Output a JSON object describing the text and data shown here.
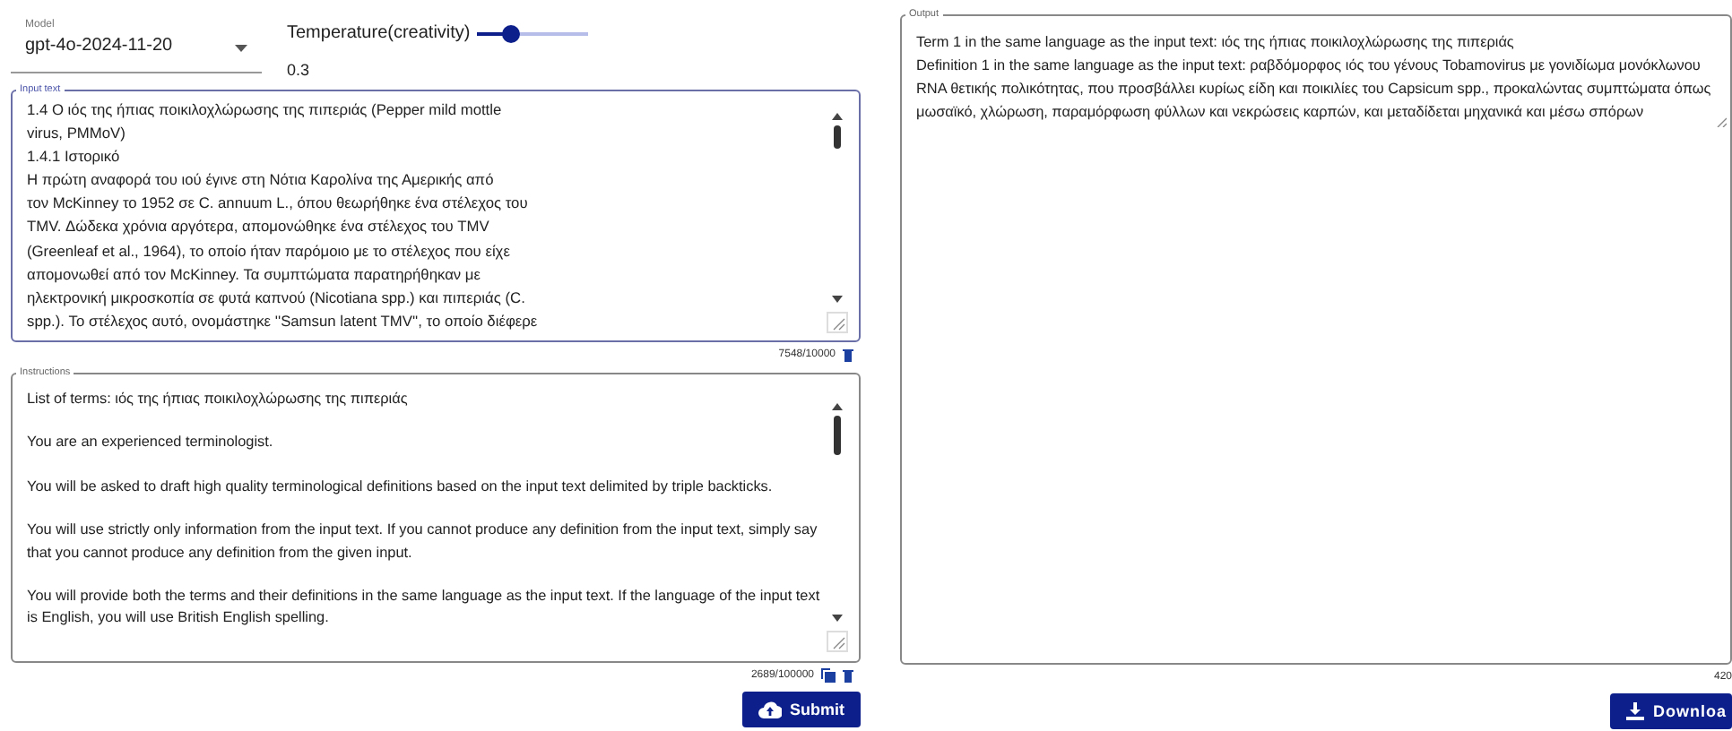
{
  "model_select": {
    "label": "Model",
    "value": "gpt-4o-2024-11-20"
  },
  "temperature": {
    "label": "Temperature(creativity)",
    "level": 0.3,
    "reading": "0.3"
  },
  "input_text": {
    "label": "Input text",
    "lines": [
      "1.4 Ο ιός της ήπιας ποικιλοχλώρωσης της πιπεριάς (Pepper mild mottle",
      "virus, PMMoV)",
      "1.4.1 Ιστορικό",
      "Η πρώτη αναφορά του ιού έγινε στη Νότια Καρολίνα της Αμερικής από",
      "τον McKinney το 1952 σε C. annuum L., όπου θεωρήθηκε ένα στέλεχος του",
      "TMV. Δώδεκα χρόνια αργότερα, απομονώθηκε ένα στέλεχος του TMV",
      "(Greenleaf et al., 1964), το οποίο ήταν παρόμοιο με το στέλεχος που είχε",
      "απομονωθεί από τον McKinney. Τα συμπτώματα παρατηρήθηκαν με",
      "ηλεκτρονική μικροσκοπία σε φυτά καπνού (Nicotiana spp.) και πιπεριάς (C.",
      "spp.). Το στέλεχος αυτό, ονομάστηκε ''Samsun latent TMV'', το οποίο διέφερε"
    ],
    "counter": "7548/10000"
  },
  "instructions": {
    "label": "Instructions",
    "paragraphs": [
      "List of terms: ιός της ήπιας ποικιλοχλώρωσης της πιπεριάς",
      "You are an experienced terminologist.",
      "You will be asked to draft high quality terminological definitions based on the input text delimited by triple backticks.",
      "You will use strictly only information from the input text. If you cannot produce any definition from the input text, simply say that you cannot produce any definition from the given input.",
      "You will provide both the terms and their definitions in the same language as the input text. If the language of the input text is English, you will use British English spelling."
    ],
    "counter": "2689/100000"
  },
  "submit_button": "Submit",
  "output": {
    "label": "Output",
    "lines": [
      "Term 1 in the same language as the input text: ιός της ήπιας ποικιλοχλώρωσης της πιπεριάς",
      "Definition 1 in the same language as the input text: ραβδόμορφος ιός του γένους Tobamovirus με γονιδίωμα μονόκλωνου RNA θετικής πολικότητας, που προσβάλλει κυρίως είδη και ποικιλίες του Capsicum spp., προκαλώντας συμπτώματα όπως μωσαϊκό, χλώρωση, παραμόρφωση φύλλων και νεκρώσεις καρπών, και μεταδίδεται μηχανικά και μέσω σπόρων"
    ],
    "counter": "420"
  },
  "download_button": "Downloa"
}
